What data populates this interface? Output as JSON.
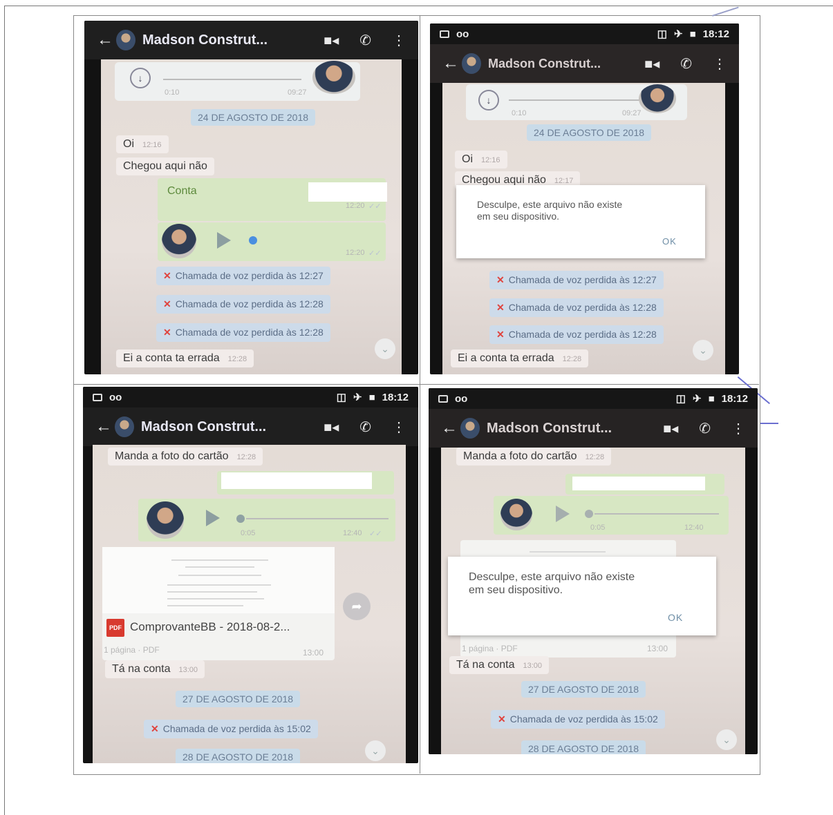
{
  "status_bar": {
    "time": "18:12",
    "left_icons": [
      "message-icon",
      "voicemail-icon"
    ],
    "right_icons": [
      "vibrate-icon",
      "airplane-icon",
      "battery-icon"
    ]
  },
  "chat_header": {
    "contact_name": "Madson Construt...",
    "icons": [
      "back-arrow-icon",
      "video-call-icon",
      "phone-icon",
      "more-vert-icon"
    ]
  },
  "audio_message": {
    "elapsed": "0:10",
    "duration": "09:27"
  },
  "panel_1": {
    "date": "24 DE AGOSTO DE 2018",
    "messages": [
      {
        "text": "Oi",
        "time": "12:16"
      },
      {
        "text": "Chegou aqui não",
        "time": ""
      }
    ],
    "outgoing_text": "Conta",
    "outgoing_times": [
      "12:20",
      "12:20"
    ],
    "missed_calls": [
      "Chamada de voz perdida às 12:27",
      "Chamada de voz perdida às 12:28",
      "Chamada de voz perdida às 12:28"
    ],
    "last_message": {
      "text": "Ei a conta ta errada",
      "time": "12:28"
    }
  },
  "panel_2": {
    "date": "24 DE AGOSTO DE 2018",
    "messages": [
      {
        "text": "Oi",
        "time": "12:16"
      },
      {
        "text": "Chegou aqui não",
        "time": "12:17"
      }
    ],
    "dialog": {
      "text": "Desculpe, este arquivo não existe\nem seu dispositivo.",
      "ok": "OK"
    },
    "missed_calls": [
      "Chamada de voz perdida às 12:27",
      "Chamada de voz perdida às 12:28",
      "Chamada de voz perdida às 12:28"
    ],
    "last_message": {
      "text": "Ei a conta ta errada",
      "time": "12:28"
    }
  },
  "panel_3": {
    "first_message": {
      "text": "Manda a foto do cartão",
      "time": "12:28"
    },
    "voice": {
      "duration": "0:05",
      "time": "12:40"
    },
    "pdf": {
      "name": "ComprovanteBB - 2018-08-2...",
      "badge": "PDF",
      "meta": "1 página · PDF",
      "time": "13:00"
    },
    "message": {
      "text": "Tá na conta",
      "time": "13:00"
    },
    "date_1": "27 DE AGOSTO DE 2018",
    "missed_call": "Chamada de voz perdida às 15:02",
    "date_2": "28 DE AGOSTO DE 2018"
  },
  "panel_4": {
    "first_message": {
      "text": "Manda a foto do cartão",
      "time": "12:28"
    },
    "voice": {
      "duration": "0:05",
      "time": "12:40"
    },
    "dialog": {
      "text": "Desculpe, este arquivo não existe\nem seu dispositivo.",
      "ok": "OK"
    },
    "pdf_meta": {
      "meta": "1 página · PDF",
      "time": "13:00"
    },
    "message": {
      "text": "Tá na conta",
      "time": "13:00"
    },
    "date_1": "27 DE AGOSTO DE 2018",
    "missed_call": "Chamada de voz perdida às 15:02",
    "date_2": "28 DE AGOSTO DE 2018"
  },
  "colors": {
    "missed_call_x": "#e0433d",
    "date_pill": "#c9dbe9",
    "outgoing_bubble": "#d7e7c3",
    "pdf_badge": "#d83a2f",
    "progress_dot": "#4a8fe0"
  }
}
